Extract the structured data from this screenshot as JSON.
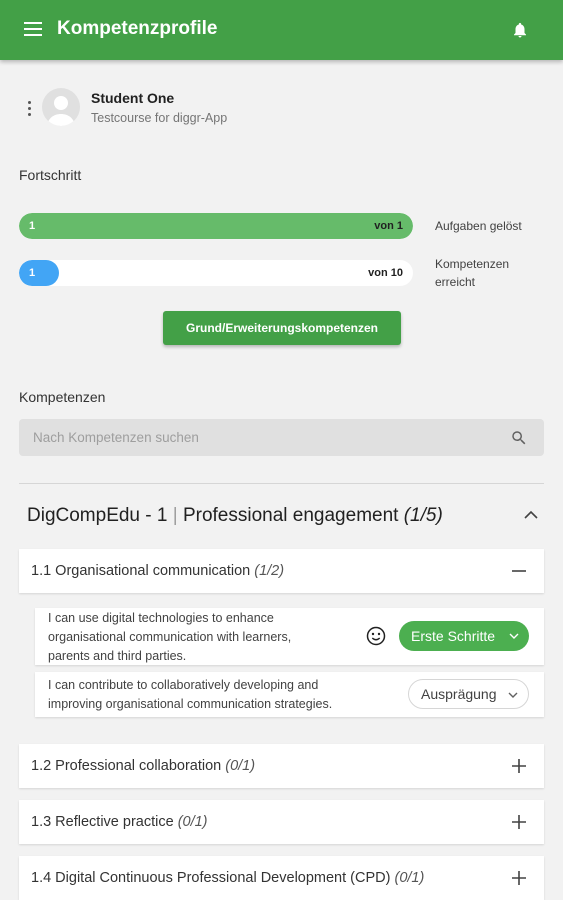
{
  "appbar": {
    "title": "Kompetenzprofile"
  },
  "user": {
    "name": "Student One",
    "course": "Testcourse for diggr-App"
  },
  "progress": {
    "section_label": "Fortschritt",
    "tasks": {
      "start": "1",
      "end": "von 1",
      "caption": "Aufgaben gelöst",
      "fraction": 1.0,
      "color": "#66bb6a"
    },
    "competences": {
      "start": "1",
      "end": "von 10",
      "caption": "Kompetenzen erreicht",
      "fraction": 0.1,
      "color": "#42a5f5"
    },
    "button_label": "Grund/Erweiterungskompetenzen"
  },
  "competences": {
    "section_label": "Kompetenzen",
    "search_placeholder": "Nach Kompetenzen suchen"
  },
  "group": {
    "code": "DigCompEdu - 1",
    "separator": "|",
    "name": "Professional engagement",
    "count": "(1/5)"
  },
  "areas": [
    {
      "title": "1.1 Organisational communication",
      "count": "(1/2)",
      "expanded": true
    },
    {
      "title": "1.2 Professional collaboration",
      "count": "(0/1)",
      "expanded": false
    },
    {
      "title": "1.3 Reflective practice",
      "count": "(0/1)",
      "expanded": false
    },
    {
      "title": "1.4 Digital Continuous Professional Development (CPD)",
      "count": "(0/1)",
      "expanded": false
    }
  ],
  "items": [
    {
      "lines": [
        "I can use digital technologies to enhance",
        "organisational communication with learners,",
        "parents and third parties."
      ],
      "level": "Erste Schritte",
      "has_smiley": true
    },
    {
      "lines": [
        "I can contribute to collaboratively developing and",
        "improving organisational communication strategies."
      ],
      "level": "Ausprägung",
      "has_smiley": false
    }
  ],
  "colors": {
    "primary": "#43a047",
    "accent_blue": "#42a5f5",
    "chip_green": "#4caf50"
  }
}
